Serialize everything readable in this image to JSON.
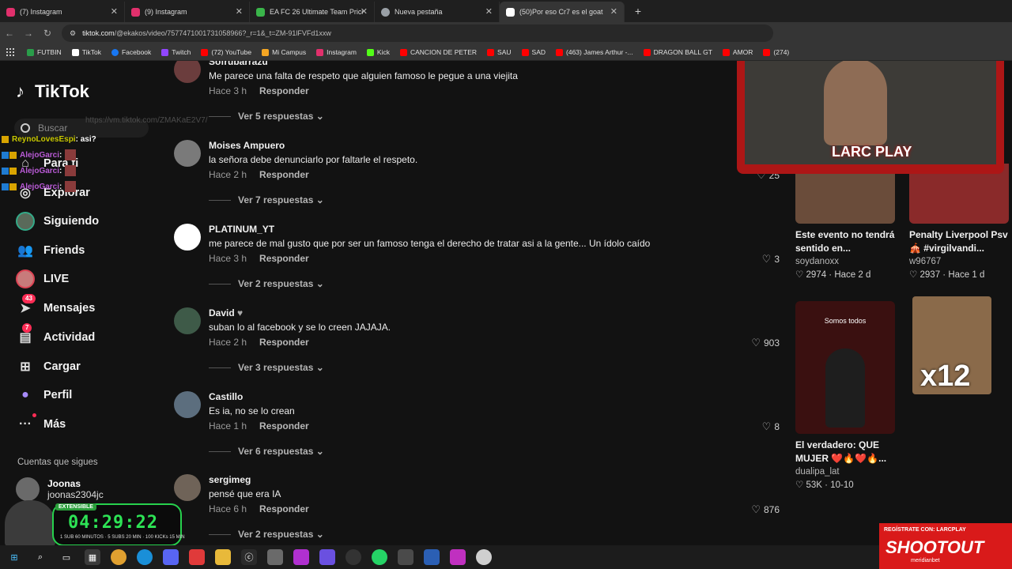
{
  "browser": {
    "tabs": [
      {
        "label": "(7) Instagram",
        "color": "#e1306c"
      },
      {
        "label": "(9) Instagram",
        "color": "#e1306c"
      },
      {
        "label": "EA FC 26 Ultimate Team Prices",
        "color": "#3ab54a"
      },
      {
        "label": "Nueva pestaña",
        "color": "#9aa0a6"
      },
      {
        "label": "(50)Por eso Cr7 es el goat",
        "color": "#ffffff",
        "active": true
      }
    ],
    "url_host": "tiktok.com",
    "url_path": "/@ekakos/video/7577471001731058966?_r=1&_t=ZM-91lFVFd1xxw",
    "bookmarks": [
      {
        "label": "FUTBIN",
        "color": "#2a9d4a"
      },
      {
        "label": "TikTok",
        "color": "#ffffff"
      },
      {
        "label": "Facebook",
        "color": "#1877f2"
      },
      {
        "label": "Twitch",
        "color": "#9146ff"
      },
      {
        "label": "(72) YouTube",
        "color": "#ff0000"
      },
      {
        "label": "Mi Campus",
        "color": "#f5a623"
      },
      {
        "label": "Instagram",
        "color": "#e1306c"
      },
      {
        "label": "Kick",
        "color": "#53fc18"
      },
      {
        "label": "CANCION DE PETER",
        "color": "#ff0000"
      },
      {
        "label": "SAU",
        "color": "#ff0000"
      },
      {
        "label": "SAD",
        "color": "#ff0000"
      },
      {
        "label": "(463) James Arthur -...",
        "color": "#ff0000"
      },
      {
        "label": "DRAGON BALL GT",
        "color": "#ff0000"
      },
      {
        "label": "AMOR",
        "color": "#ff0000"
      },
      {
        "label": "(274)",
        "color": "#ff0000"
      }
    ]
  },
  "sidebar": {
    "logo": "TikTok",
    "search_placeholder": "Buscar",
    "overlay_url": "https://vm.tiktok.com/ZMAKaE2V7/",
    "nav": [
      {
        "label": "Para ti"
      },
      {
        "label": "Explorar"
      },
      {
        "label": "Siguiendo"
      },
      {
        "label": "Friends"
      },
      {
        "label": "LIVE"
      },
      {
        "label": "Mensajes",
        "badge": "43"
      },
      {
        "label": "Actividad",
        "badge": "7"
      },
      {
        "label": "Cargar"
      },
      {
        "label": "Perfil"
      },
      {
        "label": "Más"
      }
    ],
    "following_title": "Cuentas que sigues",
    "following": {
      "name": "Joonas",
      "handle": "joonas2304jc"
    }
  },
  "stream_chat": [
    {
      "user": "ReynoLovesEspi",
      "message": ": asi?"
    },
    {
      "user": "AlejoGarci",
      "message": ":"
    },
    {
      "user": "AlejoGarci",
      "message": ":"
    },
    {
      "user": "AlejoGarci",
      "message": ":"
    },
    {
      "user": "AlejoGarci",
      "message": ":"
    }
  ],
  "timer": {
    "label": "EXTENSIBLE",
    "time": "04:29:22",
    "meta": "1 SUB 60 MINUTOS · 5 SUBS 20 MIN · 100 KICKs 15 MIN"
  },
  "comments": [
    {
      "name": "Sofrubarrazu",
      "text": "Me parece una falta de respeto que alguien famoso le pegue a una viejita",
      "time": "Hace 3 h",
      "reply": "Responder",
      "likes": "",
      "replies": "Ver 5 respuestas"
    },
    {
      "name": "Moises Ampuero",
      "text": "la señora debe denunciarlo por faltarle el respeto.",
      "time": "Hace 2 h",
      "reply": "Responder",
      "likes": "25",
      "replies": "Ver 7 respuestas"
    },
    {
      "name": "PLATINUM_YT",
      "text": "me parece de mal gusto que por ser un famoso tenga el derecho de tratar asi a la gente... Un ídolo caído",
      "time": "Hace 3 h",
      "reply": "Responder",
      "likes": "3",
      "replies": "Ver 2 respuestas"
    },
    {
      "name": "David",
      "text": "suban lo al facebook y se lo creen JAJAJA.",
      "time": "Hace 2 h",
      "reply": "Responder",
      "likes": "903",
      "replies": "Ver 3 respuestas"
    },
    {
      "name": "Castillo",
      "text": "Es ia, no se lo crean",
      "time": "Hace 1 h",
      "reply": "Responder",
      "likes": "8",
      "replies": "Ver 6 respuestas"
    },
    {
      "name": "sergimeg",
      "text": "pensé que era IA",
      "time": "Hace 6 h",
      "reply": "Responder",
      "likes": "876",
      "replies": "Ver 2 respuestas"
    }
  ],
  "related": [
    {
      "title": "Este evento no tendrá sentido en...",
      "author": "soydanoxx",
      "likes": "2974",
      "when": "Hace 2 d",
      "color": "#6a4c3a"
    },
    {
      "title": "Penalty Liverpool Psv 🎪 #virgilvandi...",
      "author": "w96767",
      "likes": "2937",
      "when": "Hace 1 d",
      "color": "#8a2a2a"
    },
    {
      "title": "El verdadero: QUE MUJER ❤️🔥❤️🔥...",
      "author": "dualipa_lat",
      "likes": "53K",
      "when": "10-10",
      "color": "#3a1010",
      "overlay": "Somos todos"
    },
    {
      "title": "",
      "author": "",
      "likes": "",
      "when": "",
      "color": "#8a6a4a",
      "overlay": "x12"
    }
  ],
  "stream_overlay": {
    "cam_caption": "LARC PLAY",
    "shootout_register": "REGÍSTRATE CON: LARCPLAY",
    "shootout_title": "SHOOTOUT",
    "shootout_sub": "meridianbet"
  }
}
